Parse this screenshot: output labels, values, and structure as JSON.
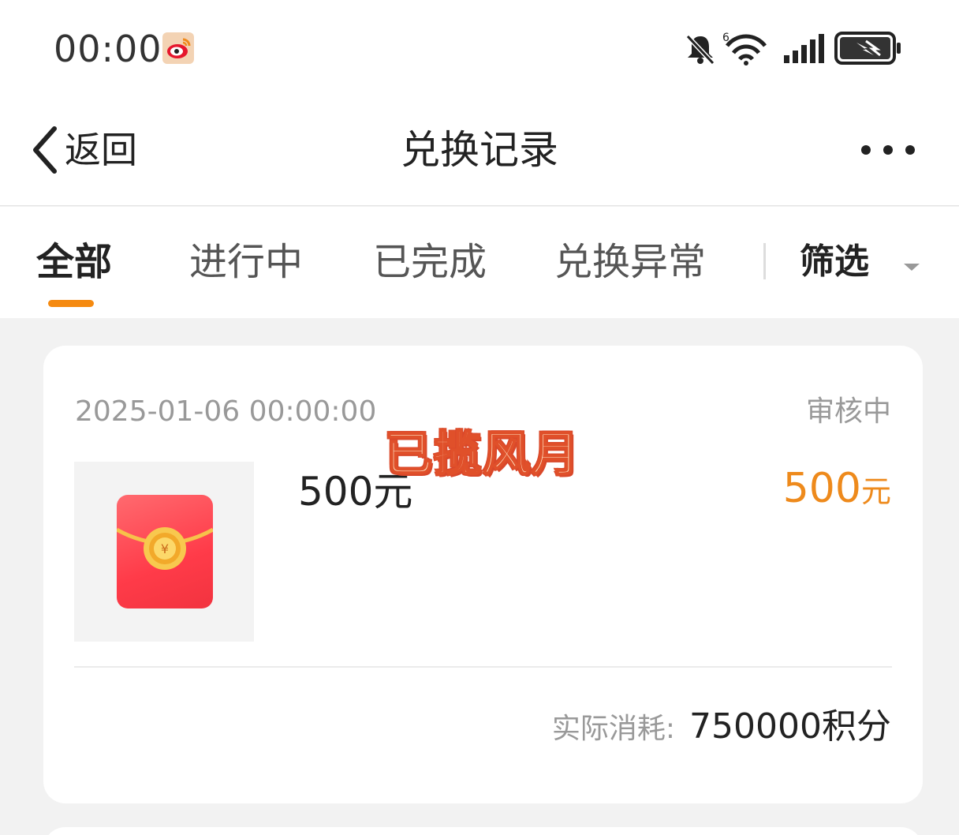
{
  "status_bar": {
    "time": "00:00",
    "battery_icon": "battery-charging-icon",
    "wifi_label": "6",
    "icons": [
      "weibo-icon",
      "bell-off-icon",
      "wifi-6-icon",
      "signal-icon",
      "battery-charging-icon"
    ]
  },
  "nav": {
    "back_label": "返回",
    "title": "兑换记录",
    "more_icon": "more-dots-icon"
  },
  "tabs": [
    {
      "label": "全部",
      "active": true
    },
    {
      "label": "进行中",
      "active": false
    },
    {
      "label": "已完成",
      "active": false
    },
    {
      "label": "兑换异常",
      "active": false
    }
  ],
  "filter": {
    "label": "筛选",
    "icon": "caret-down-icon"
  },
  "records": [
    {
      "time": "2025-01-06 00:00:00",
      "status": "审核中",
      "product_name": "500元",
      "price_value": "500",
      "price_unit": "元",
      "cost_label": "实际消耗:",
      "cost_value": "750000积分",
      "thumb_icon": "red-envelope-icon"
    }
  ],
  "overlay": {
    "sticker_text": "已揽风月"
  },
  "colors": {
    "accent": "#f58a10",
    "price": "#ee8a1c",
    "background": "#f2f2f2",
    "text_primary": "#222222",
    "text_secondary": "#999999"
  }
}
